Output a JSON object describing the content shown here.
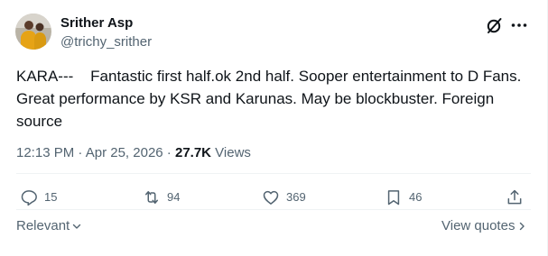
{
  "author": {
    "name": "Srither Asp",
    "handle": "@trichy_srither"
  },
  "tweet": {
    "text": "KARA---    Fantastic first half.ok 2nd half. Sooper entertainment to D Fans. Great performance by KSR and Karunas. May be blockbuster. Foreign source"
  },
  "meta": {
    "time": "12:13 PM",
    "separator1": " · ",
    "date": "Apr 25, 2026",
    "separator2": " · ",
    "views_count": "27.7K",
    "views_label": " Views"
  },
  "actions": {
    "replies": "15",
    "reposts": "94",
    "likes": "369",
    "bookmarks": "46"
  },
  "footer": {
    "sort_label": "Relevant",
    "quotes_label": "View quotes"
  },
  "icons": {
    "grok": "grok-icon",
    "more": "more-icon",
    "reply": "reply-icon",
    "repost": "repost-icon",
    "like": "heart-icon",
    "bookmark": "bookmark-icon",
    "share": "share-icon"
  },
  "colors": {
    "text": "#0f1419",
    "secondary": "#536471",
    "divider": "#eff3f4"
  }
}
